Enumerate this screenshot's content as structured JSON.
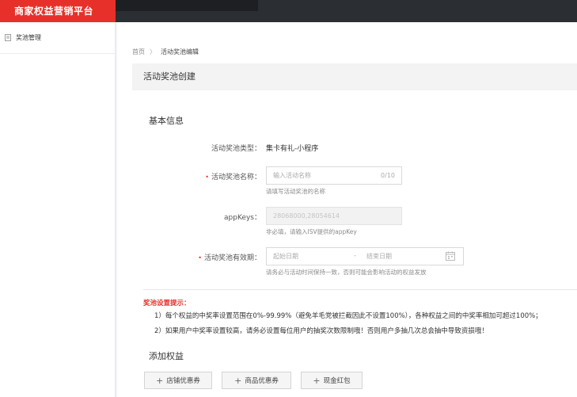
{
  "app": {
    "brand": "商家权益营销平台"
  },
  "sidebar": {
    "items": [
      {
        "label": "奖池管理",
        "icon": "list-icon"
      }
    ]
  },
  "breadcrumb": {
    "home": "首页",
    "separator": "〉",
    "current": "活动奖池编辑"
  },
  "page": {
    "title": "活动奖池创建"
  },
  "basic_info": {
    "section_title": "基本信息",
    "pool_type": {
      "label": "活动奖池类型：",
      "value": "集卡有礼-小程序"
    },
    "pool_name": {
      "required_mark": "•",
      "label": "活动奖池名称：",
      "placeholder": "输入活动名称",
      "counter": "0/10",
      "hint": "请填写活动奖池的名称"
    },
    "app_keys": {
      "label": "appKeys：",
      "value": "28068000,28054614",
      "hint": "非必填，请输入ISV提供的appKey"
    },
    "validity": {
      "required_mark": "•",
      "label": "活动奖池有效期：",
      "start_placeholder": "起始日期",
      "separator": "-",
      "end_placeholder": "结束日期",
      "hint": "请务必与活动时间保持一致，否则可能会影响活动的权益发放",
      "icon": "calendar-icon"
    }
  },
  "tips": {
    "title": "奖池设置提示：",
    "items": [
      "1）每个权益的中奖率设置范围在0%-99.99%（避免羊毛党被拦截因此不设置100%），各种权益之间的中奖率相加可超过100%；",
      "2）如果用户中奖率设置较高，请务必设置每位用户的抽奖次数限制哦！否则用户多抽几次总会抽中导致资损哦！"
    ]
  },
  "add_rights": {
    "section_title": "添加权益",
    "buttons": [
      {
        "label": "店铺优惠券"
      },
      {
        "label": "商品优惠券"
      },
      {
        "label": "现金红包"
      }
    ]
  },
  "colors": {
    "brand": "#e8302a",
    "topbar": "#2b2e33",
    "required": "#e8302a"
  }
}
